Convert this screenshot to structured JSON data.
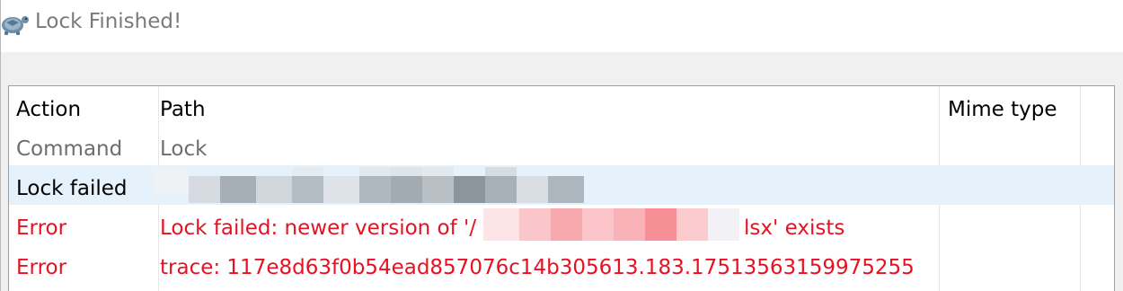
{
  "window": {
    "title": "Lock Finished!",
    "icon": "tortoise-icon"
  },
  "table": {
    "columns": [
      "Action",
      "Path",
      "Mime type"
    ],
    "rows": [
      {
        "action": "Command",
        "path": "Lock",
        "mime": "",
        "style": "muted"
      },
      {
        "action": "Lock failed",
        "path": "",
        "mime": "",
        "style": "selected"
      },
      {
        "action": "Error",
        "path_prefix": "Lock failed: newer version of '/",
        "path_suffix": "lsx' exists",
        "mime": "",
        "style": "error"
      },
      {
        "action": "Error",
        "path": "trace: 117e8d63f0b54ead857076c14b305613.183.17513563159975255",
        "mime": "",
        "style": "error"
      }
    ]
  },
  "colors": {
    "error": "#e81123",
    "selected_row": "#e5f1fb",
    "muted_text": "#6d6d6d"
  }
}
